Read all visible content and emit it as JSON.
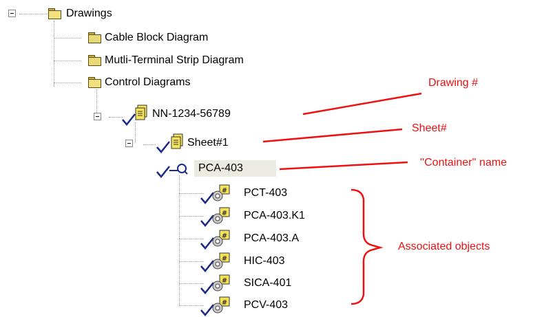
{
  "tree": {
    "root_label": "Drawings",
    "folders": [
      "Cable Block Diagram",
      "Mutli-Terminal Strip Diagram",
      "Control Diagrams"
    ],
    "drawing_label": "NN-1234-56789",
    "sheet_label": "Sheet#1",
    "container_label": "PCA-403",
    "objects": [
      "PCT-403",
      "PCA-403.K1",
      "PCA-403.A",
      "HIC-403",
      "SICA-401",
      "PCV-403"
    ]
  },
  "annotations": {
    "drawing": "Drawing #",
    "sheet": "Sheet#",
    "container": "''Container'' name",
    "associated": "Associated objects"
  },
  "colors": {
    "annotation": "#ee1111",
    "check": "#1a2a8a",
    "selection_bg": "#ecebe2",
    "folder": "#e8d878"
  },
  "icons": {
    "toggle": "collapse-box-icon",
    "folder": "folder-icon",
    "document": "document-icon",
    "check": "checkmark-icon",
    "container": "magnifier-icon",
    "object": "tagged-object-icon"
  }
}
